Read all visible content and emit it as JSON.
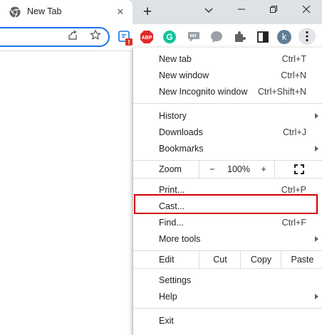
{
  "tab": {
    "title": "New Tab",
    "close": "✕"
  },
  "window": {
    "new_tab": "+",
    "restore": "❐",
    "close": "✕"
  },
  "toolbar": {
    "extensions": [
      {
        "name": "note-extension-icon",
        "badge": "!"
      },
      {
        "name": "adblock-plus-icon",
        "text": "ABP"
      },
      {
        "name": "grammarly-icon",
        "text": "G"
      },
      {
        "name": "quote-extension-icon"
      },
      {
        "name": "chat-extension-icon"
      },
      {
        "name": "extensions-puzzle-icon"
      },
      {
        "name": "side-panel-icon"
      }
    ],
    "profile_letter": "k"
  },
  "menu": {
    "group1": [
      {
        "label": "New tab",
        "shortcut": "Ctrl+T"
      },
      {
        "label": "New window",
        "shortcut": "Ctrl+N"
      },
      {
        "label": "New Incognito window",
        "shortcut": "Ctrl+Shift+N"
      }
    ],
    "group2": [
      {
        "label": "History",
        "submenu": true
      },
      {
        "label": "Downloads",
        "shortcut": "Ctrl+J"
      },
      {
        "label": "Bookmarks",
        "submenu": true
      }
    ],
    "zoom": {
      "label": "Zoom",
      "minus": "−",
      "value": "100%",
      "plus": "+"
    },
    "group3": [
      {
        "label": "Print...",
        "shortcut": "Ctrl+P"
      },
      {
        "label": "Cast..."
      },
      {
        "label": "Find...",
        "shortcut": "Ctrl+F"
      },
      {
        "label": "More tools",
        "submenu": true
      }
    ],
    "edit": {
      "label": "Edit",
      "cut": "Cut",
      "copy": "Copy",
      "paste": "Paste"
    },
    "group4": [
      {
        "label": "Settings"
      },
      {
        "label": "Help",
        "submenu": true
      }
    ],
    "exit": "Exit"
  },
  "colors": {
    "highlight": "#d00000",
    "accent": "#1a73e8",
    "abp": "#e02b2b",
    "grammarly": "#15c39a",
    "profile": "#5f7d95"
  }
}
